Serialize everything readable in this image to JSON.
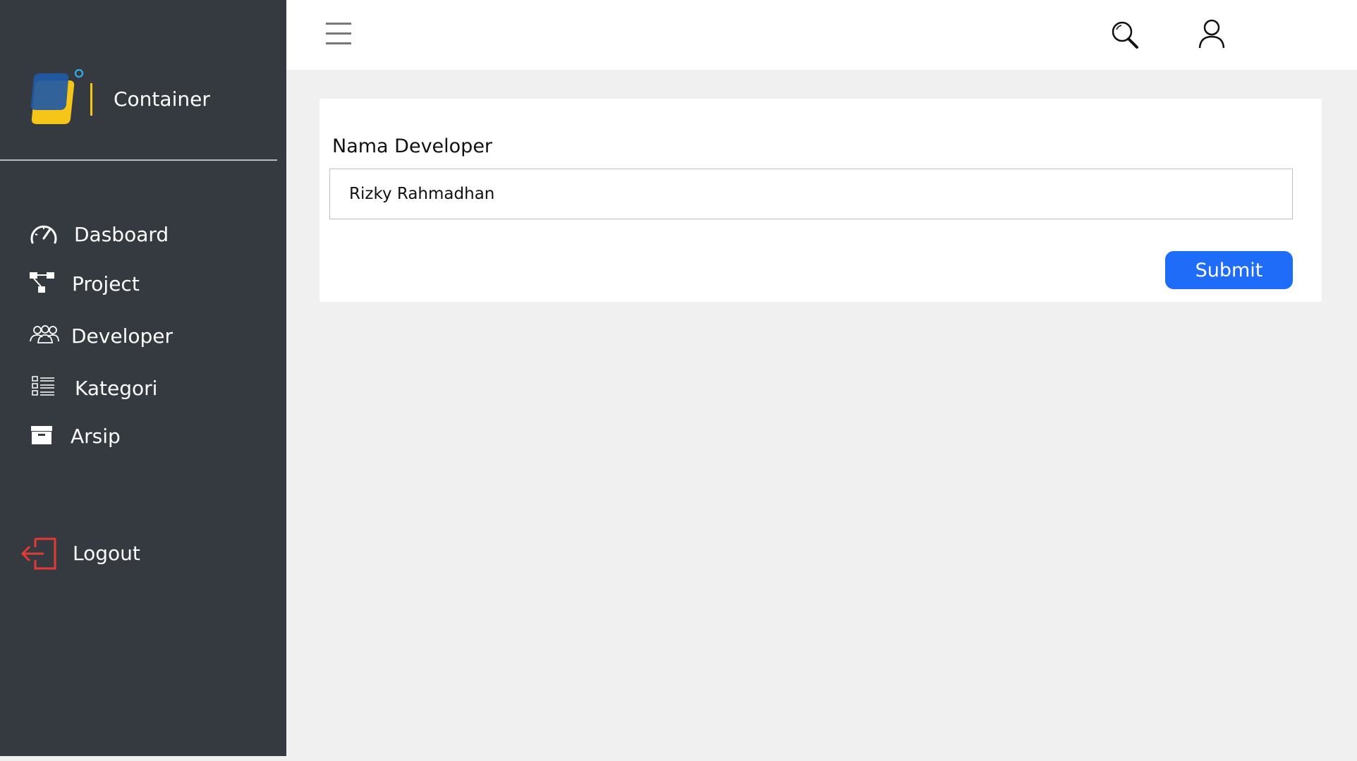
{
  "brand": {
    "name": "Container"
  },
  "sidebar": {
    "items": [
      {
        "label": "Dasboard",
        "icon": "speedometer-icon"
      },
      {
        "label": "Project",
        "icon": "project-tree-icon"
      },
      {
        "label": "Developer",
        "icon": "users-group-icon"
      },
      {
        "label": "Kategori",
        "icon": "list-icon"
      },
      {
        "label": "Arsip",
        "icon": "archive-box-icon"
      }
    ],
    "logout": {
      "label": "Logout",
      "icon": "logout-icon"
    }
  },
  "topbar": {
    "menu_icon": "hamburger-menu-icon",
    "search_icon": "search-icon",
    "user_icon": "user-icon"
  },
  "form": {
    "field_label": "Nama Developer",
    "field_value": "Rizky Rahmadhan",
    "submit_label": "Submit"
  },
  "colors": {
    "sidebar_bg": "#343a40",
    "page_bg": "#f0f0f0",
    "accent": "#1e6cf7",
    "logout_red": "#e53935",
    "logo_blue": "#1f5aa6",
    "logo_yellow": "#f5c518"
  }
}
